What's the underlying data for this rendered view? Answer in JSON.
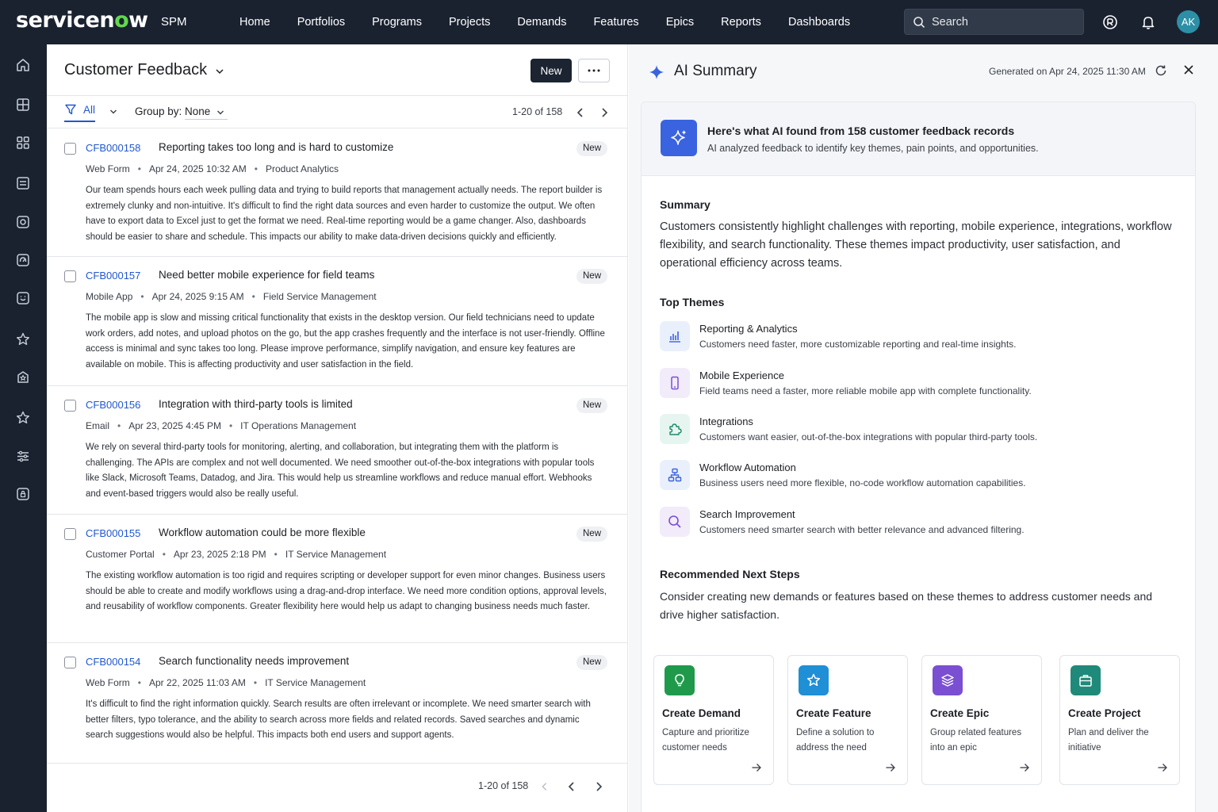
{
  "topbar": {
    "logo": "servicenow",
    "app_name": "SPM",
    "nav": [
      "Home",
      "Portfolios",
      "Programs",
      "Projects",
      "Demands",
      "Features",
      "Epics",
      "Reports",
      "Dashboards"
    ],
    "search_placeholder": "Search",
    "avatar_initials": "AK"
  },
  "sidebar": {
    "icons": [
      "home-icon",
      "grid-icon",
      "apps-icon",
      "list-icon",
      "target-icon",
      "gauge-icon",
      "smile-icon",
      "star-icon",
      "badge-icon",
      "favorite-icon",
      "sliders-icon",
      "lock-icon"
    ]
  },
  "list": {
    "title": "Customer Feedback",
    "new_label": "New",
    "filter_label": "All",
    "group_by_label": "Group by:",
    "group_by_value": "None",
    "pager": "1-20 of 158",
    "records": [
      {
        "id": "CFB000158",
        "title": "Reporting takes too long and is hard to customize",
        "badge": "New",
        "source": "Web Form",
        "date": "Apr 24, 2025 10:32 AM",
        "category": "Product Analytics",
        "desc": "Our team spends hours each week pulling data and trying to build reports that management actually needs. The report builder is extremely clunky and non-intuitive. It's difficult to find the right data sources and even harder to customize the output. We often have to export data to Excel just to get the format we need. Real-time reporting would be a game changer. Also, dashboards should be easier to share and schedule. This impacts our ability to make data-driven decisions quickly and efficiently."
      },
      {
        "id": "CFB000157",
        "title": "Need better mobile experience for field teams",
        "badge": "New",
        "source": "Mobile App",
        "date": "Apr 24, 2025 9:15 AM",
        "category": "Field Service Management",
        "desc": "The mobile app is slow and missing critical functionality that exists in the desktop version. Our field technicians need to update work orders, add notes, and upload photos on the go, but the app crashes frequently and the interface is not user-friendly. Offline access is minimal and sync takes too long. Please improve performance, simplify navigation, and ensure key features are available on mobile. This is affecting productivity and user satisfaction in the field."
      },
      {
        "id": "CFB000156",
        "title": "Integration with third-party tools is limited",
        "badge": "New",
        "source": "Email",
        "date": "Apr 23, 2025 4:45 PM",
        "category": "IT Operations Management",
        "desc": "We rely on several third-party tools for monitoring, alerting, and collaboration, but integrating them with the platform is challenging. The APIs are complex and not well documented. We need smoother out-of-the-box integrations with popular tools like Slack, Microsoft Teams, Datadog, and Jira. This would help us streamline workflows and reduce manual effort. Webhooks and event-based triggers would also be really useful."
      },
      {
        "id": "CFB000155",
        "title": "Workflow automation could be more flexible",
        "badge": "New",
        "source": "Customer Portal",
        "date": "Apr 23, 2025 2:18 PM",
        "category": "IT Service Management",
        "desc": "The existing workflow automation is too rigid and requires scripting or developer support for even minor changes. Business users should be able to create and modify workflows using a drag-and-drop interface. We need more condition options, approval levels, and reusability of workflow components. Greater flexibility here would help us adapt to changing business needs much faster."
      },
      {
        "id": "CFB000154",
        "title": "Search functionality needs improvement",
        "badge": "New",
        "source": "Web Form",
        "date": "Apr 22, 2025 11:03 AM",
        "category": "IT Service Management",
        "desc": "It's difficult to find the right information quickly. Search results are often irrelevant or incomplete. We need smarter search with better filters, typo tolerance, and the ability to search across more fields and related records. Saved searches and dynamic search suggestions would also be helpful. This impacts both end users and support agents."
      }
    ],
    "pager_bottom": "1-20 of 158"
  },
  "ai": {
    "title": "AI Summary",
    "generated": "Generated on Apr 24, 2025 11:30 AM",
    "banner_title": "Here's what AI found from 158 customer feedback records",
    "banner_sub": "AI analyzed feedback to identify key themes, pain points, and opportunities.",
    "summary_heading": "Summary",
    "summary_text": "Customers consistently highlight challenges with reporting, mobile experience, integrations, workflow flexibility, and search functionality. These themes impact productivity, user satisfaction, and operational efficiency across teams.",
    "themes_heading": "Top Themes",
    "themes": [
      {
        "title": "Reporting & Analytics",
        "desc": "Customers need faster, more customizable reporting and real-time insights.",
        "icon": "bar-chart-icon",
        "bg": "#eaf0fb",
        "color": "#3a63e0"
      },
      {
        "title": "Mobile Experience",
        "desc": "Field teams need a faster, more reliable mobile app with complete functionality.",
        "icon": "mobile-icon",
        "bg": "#f2ebfa",
        "color": "#7a4fd1"
      },
      {
        "title": "Integrations",
        "desc": "Customers want easier, out-of-the-box integrations with popular third-party tools.",
        "icon": "puzzle-icon",
        "bg": "#e6f5f0",
        "color": "#1f8a6a"
      },
      {
        "title": "Workflow Automation",
        "desc": "Business users need more flexible, no-code workflow automation capabilities.",
        "icon": "workflow-icon",
        "bg": "#eaf0fb",
        "color": "#3a63e0"
      },
      {
        "title": "Search Improvement",
        "desc": "Customers need smarter search with better relevance and advanced filtering.",
        "icon": "search-icon",
        "bg": "#f2ebfa",
        "color": "#7a4fd1"
      }
    ],
    "next_heading": "Recommended Next Steps",
    "next_text": "Consider creating new demands or features based on these themes to address customer needs and drive higher satisfaction.",
    "actions": [
      {
        "title": "Create Demand",
        "desc": "Capture and prioritize customer needs",
        "icon": "lightbulb-icon",
        "color": "#1f9a4b"
      },
      {
        "title": "Create Feature",
        "desc": "Define a solution to address the need",
        "icon": "star-icon",
        "color": "#1f8fd6"
      },
      {
        "title": "Create Epic",
        "desc": "Group related features into an epic",
        "icon": "layers-icon",
        "color": "#7a4fd1"
      },
      {
        "title": "Create Project",
        "desc": "Plan and deliver the initiative",
        "icon": "briefcase-icon",
        "color": "#1f8a7a"
      }
    ]
  }
}
